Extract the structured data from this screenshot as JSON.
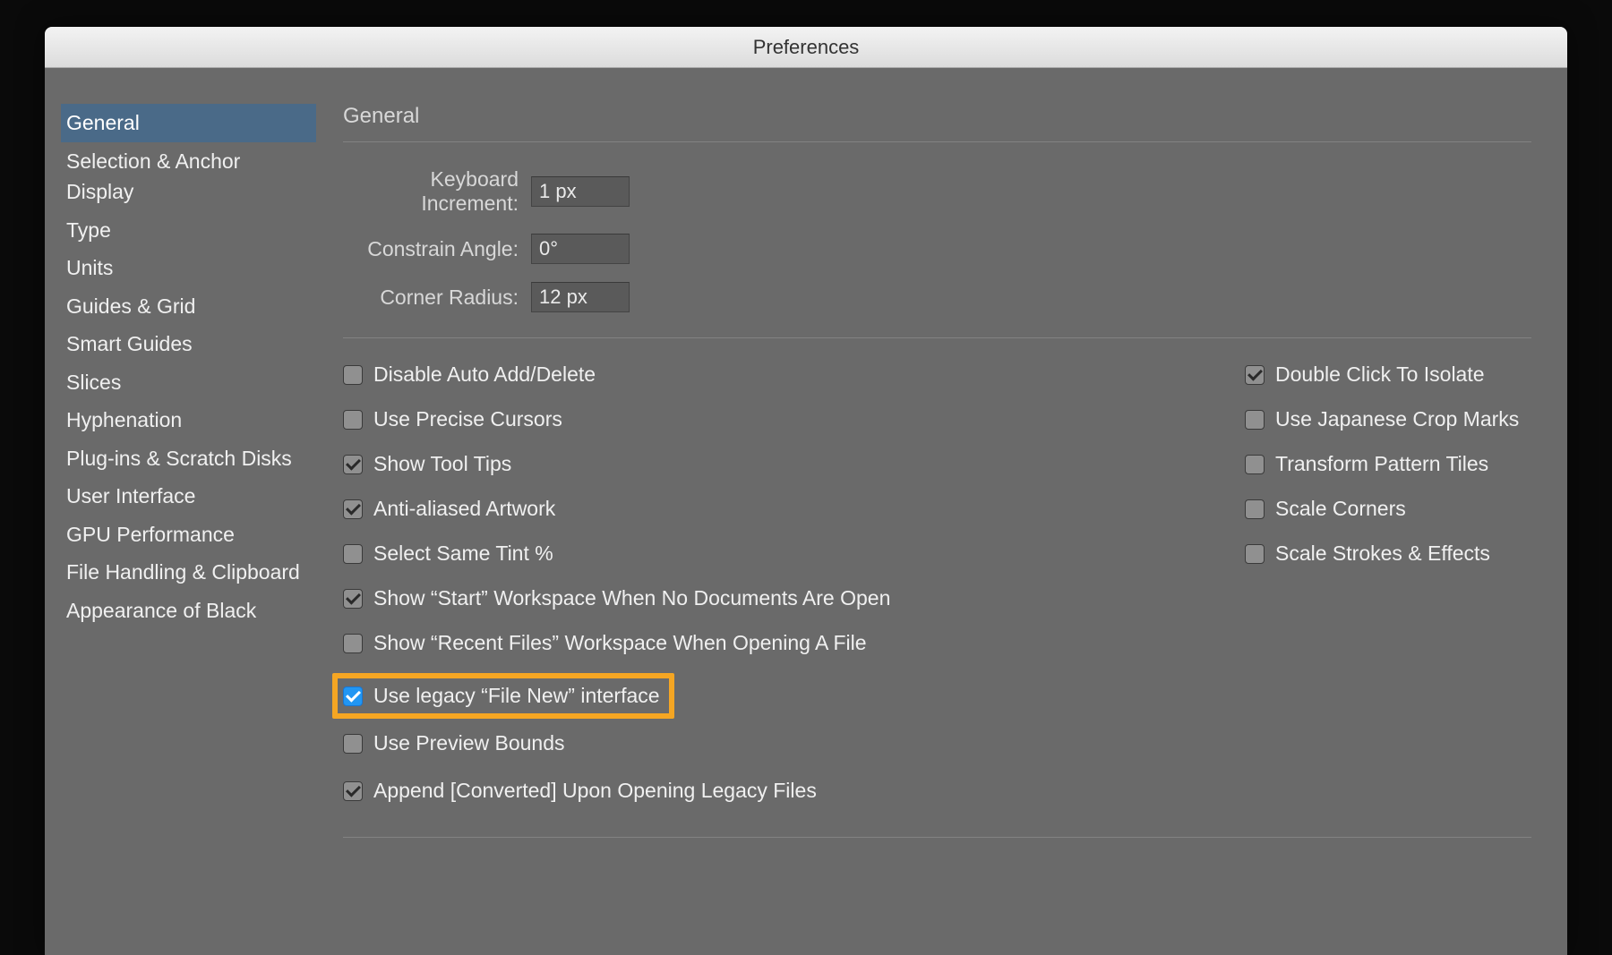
{
  "window": {
    "title": "Preferences"
  },
  "sidebar": {
    "items": [
      "General",
      "Selection & Anchor Display",
      "Type",
      "Units",
      "Guides & Grid",
      "Smart Guides",
      "Slices",
      "Hyphenation",
      "Plug-ins & Scratch Disks",
      "User Interface",
      "GPU Performance",
      "File Handling & Clipboard",
      "Appearance of Black"
    ],
    "selected_index": 0
  },
  "panel": {
    "title": "General",
    "fields": {
      "keyboard_increment": {
        "label": "Keyboard Increment:",
        "value": "1 px"
      },
      "constrain_angle": {
        "label": "Constrain Angle:",
        "value": "0°"
      },
      "corner_radius": {
        "label": "Corner Radius:",
        "value": "12 px"
      }
    },
    "checkboxes_left": [
      {
        "label": "Disable Auto Add/Delete",
        "checked": false
      },
      {
        "label": "Use Precise Cursors",
        "checked": false
      },
      {
        "label": "Show Tool Tips",
        "checked": true
      },
      {
        "label": "Anti-aliased Artwork",
        "checked": true
      },
      {
        "label": "Select Same Tint %",
        "checked": false
      },
      {
        "label": "Show “Start” Workspace When No Documents Are Open",
        "checked": true
      },
      {
        "label": "Show “Recent Files” Workspace When Opening A File",
        "checked": false
      },
      {
        "label": "Use legacy “File New” interface",
        "checked": true,
        "highlighted": true
      },
      {
        "label": "Use Preview Bounds",
        "checked": false
      },
      {
        "label": "Append [Converted] Upon Opening Legacy Files",
        "checked": true
      }
    ],
    "checkboxes_right": [
      {
        "label": "Double Click To Isolate",
        "checked": true
      },
      {
        "label": "Use Japanese Crop Marks",
        "checked": false
      },
      {
        "label": "Transform Pattern Tiles",
        "checked": false
      },
      {
        "label": "Scale Corners",
        "checked": false
      },
      {
        "label": "Scale Strokes & Effects",
        "checked": false
      }
    ]
  }
}
